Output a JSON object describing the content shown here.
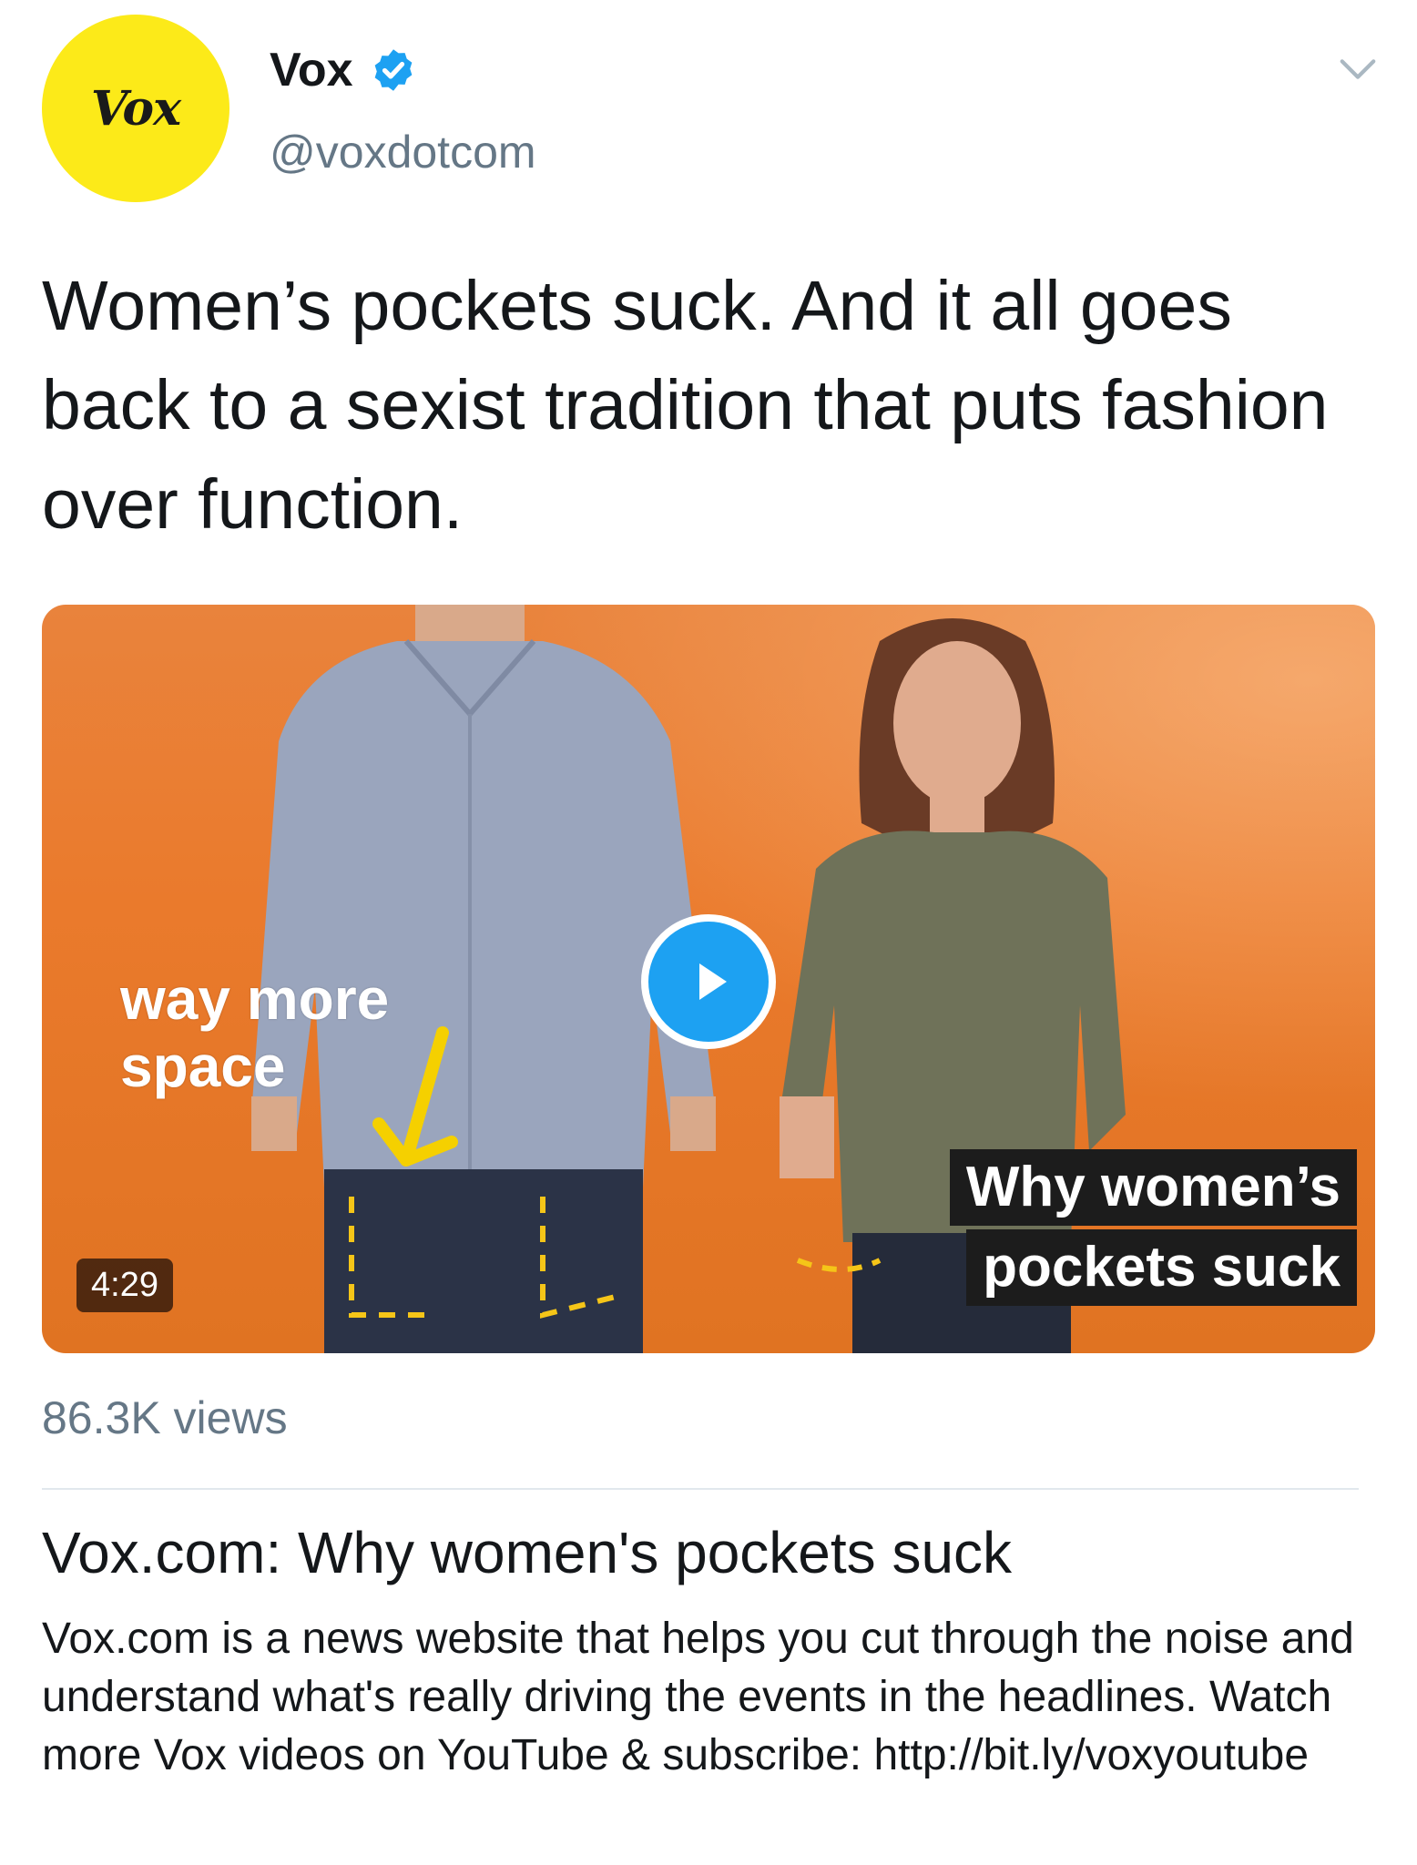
{
  "account": {
    "avatar_text": "Vox",
    "display_name": "Vox",
    "handle": "@voxdotcom",
    "verified": true,
    "brand_color": "#fcea19"
  },
  "tweet": {
    "text": "Women’s pockets suck. And it all goes back to a sexist tradition that puts fashion over function."
  },
  "media": {
    "overlay_left_line1": "way more",
    "overlay_left_line2": "space",
    "overlay_right_line1": "Why women’s",
    "overlay_right_line2": "pockets suck",
    "duration": "4:29",
    "play_icon": "play-icon",
    "background_color": "#e9833c"
  },
  "stats": {
    "views": "86.3K views"
  },
  "card": {
    "title": "Vox.com: Why women's pockets suck",
    "description": "Vox.com is a news website that helps you cut through the noise and understand what's really driving the events in the headlines. Watch more Vox videos on YouTube & subscribe: http://bit.ly/voxyoutube"
  },
  "icons": {
    "verified": "verified-badge-icon",
    "menu": "chevron-down-icon"
  }
}
